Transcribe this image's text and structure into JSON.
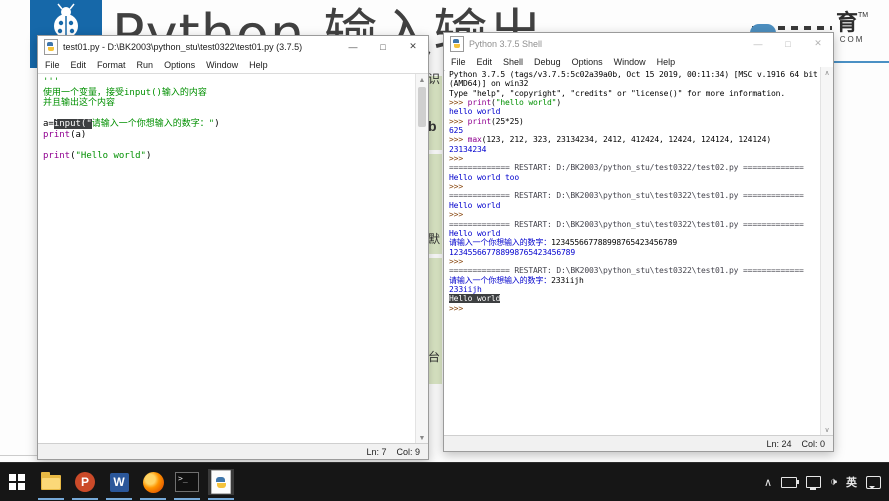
{
  "background": {
    "page_title": "Python 输入输出",
    "logo_icon": "ladybug-icon",
    "right_logo": {
      "char": "育",
      "tm": "TM",
      "com": "COM"
    },
    "strip_fragments": {
      "f1": "识",
      "f2": "b",
      "f3": "默",
      "f4": "台"
    }
  },
  "window_controls": {
    "minimize": "—",
    "maximize": "□",
    "close": "✕"
  },
  "editor_window": {
    "title": "test01.py - D:\\BK2003\\python_stu\\test0322\\test01.py (3.7.5)",
    "menu": [
      "File",
      "Edit",
      "Format",
      "Run",
      "Options",
      "Window",
      "Help"
    ],
    "code_lines": [
      [
        {
          "t": "'''",
          "c": "str"
        }
      ],
      [
        {
          "t": "使用一个变量，接受input()输入的内容",
          "c": "str"
        }
      ],
      [
        {
          "t": "并且输出这个内容",
          "c": "str"
        }
      ],
      [],
      [
        {
          "t": "a=",
          "c": "plain"
        },
        {
          "t": "input(\"",
          "c": "sel"
        },
        {
          "t": "请输入一个你想输入的数字：",
          "c": "str"
        },
        {
          "t": "\"",
          "c": "str"
        },
        {
          "t": ")",
          "c": "plain"
        }
      ],
      [
        {
          "t": "print",
          "c": "builtin"
        },
        {
          "t": "(a)",
          "c": "plain"
        }
      ],
      [],
      [
        {
          "t": "print",
          "c": "builtin"
        },
        {
          "t": "(",
          "c": "plain"
        },
        {
          "t": "\"Hello world\"",
          "c": "str"
        },
        {
          "t": ")",
          "c": "plain"
        }
      ]
    ],
    "status": {
      "line": "Ln: 7",
      "col": "Col: 9"
    }
  },
  "shell_window": {
    "title": "Python 3.7.5 Shell",
    "menu": [
      "File",
      "Edit",
      "Shell",
      "Debug",
      "Options",
      "Window",
      "Help"
    ],
    "lines": [
      [
        {
          "t": "Python 3.7.5 (tags/v3.7.5:5c02a39a0b, Oct 15 2019, 00:11:34) [MSC v.1916 64 bit",
          "c": "plain"
        }
      ],
      [
        {
          "t": "(AMD64)] on win32",
          "c": "plain"
        }
      ],
      [
        {
          "t": "Type \"help\", \"copyright\", \"credits\" or \"license()\" for more information.",
          "c": "plain"
        }
      ],
      [
        {
          "t": ">>> ",
          "c": "prompt"
        },
        {
          "t": "print",
          "c": "builtin"
        },
        {
          "t": "(",
          "c": "plain"
        },
        {
          "t": "\"hello world\"",
          "c": "str"
        },
        {
          "t": ")",
          "c": "plain"
        }
      ],
      [
        {
          "t": "hello world",
          "c": "out"
        }
      ],
      [
        {
          "t": ">>> ",
          "c": "prompt"
        },
        {
          "t": "print",
          "c": "builtin"
        },
        {
          "t": "(25*25)",
          "c": "plain"
        }
      ],
      [
        {
          "t": "625",
          "c": "out"
        }
      ],
      [
        {
          "t": ">>> ",
          "c": "prompt"
        },
        {
          "t": "max",
          "c": "builtin"
        },
        {
          "t": "(123, 212, 323, 23134234, 2412, 412424, 12424, 124124, 124124)",
          "c": "plain"
        }
      ],
      [
        {
          "t": "23134234",
          "c": "out"
        }
      ],
      [
        {
          "t": ">>>",
          "c": "prompt"
        }
      ],
      [
        {
          "t": "============= RESTART: D:/BK2003/python_stu/test0322/test02.py =============",
          "c": "restart"
        }
      ],
      [
        {
          "t": "Hello world too",
          "c": "out"
        }
      ],
      [
        {
          "t": ">>>",
          "c": "prompt"
        }
      ],
      [
        {
          "t": "============= RESTART: D:\\BK2003\\python_stu\\test0322\\test01.py =============",
          "c": "restart"
        }
      ],
      [
        {
          "t": "Hello world",
          "c": "out"
        }
      ],
      [
        {
          "t": ">>>",
          "c": "prompt"
        }
      ],
      [
        {
          "t": "============= RESTART: D:\\BK2003\\python_stu\\test0322\\test01.py =============",
          "c": "restart"
        }
      ],
      [
        {
          "t": "Hello world",
          "c": "out"
        }
      ],
      [
        {
          "t": "请输入一个你想输入的数字：",
          "c": "out"
        },
        {
          "t": "123455667788998765423456789",
          "c": "plain"
        }
      ],
      [
        {
          "t": "123455667788998765423456789",
          "c": "out"
        }
      ],
      [
        {
          "t": ">>>",
          "c": "prompt"
        }
      ],
      [
        {
          "t": "============= RESTART: D:\\BK2003\\python_stu\\test0322\\test01.py =============",
          "c": "restart"
        }
      ],
      [
        {
          "t": "请输入一个你想输入的数字：",
          "c": "out"
        },
        {
          "t": "233iijh",
          "c": "plain"
        }
      ],
      [
        {
          "t": "233iijh",
          "c": "out"
        }
      ],
      [
        {
          "t": "Hello world",
          "c": "sel"
        }
      ],
      [
        {
          "t": ">>>",
          "c": "prompt"
        }
      ]
    ],
    "status": {
      "line": "Ln: 24",
      "col": "Col: 0"
    }
  },
  "taskbar": {
    "app_icons": [
      "start-icon",
      "file-explorer-icon",
      "powerpoint-icon",
      "word-icon",
      "firefox-icon",
      "terminal-icon",
      "python-idle-icon"
    ],
    "powerpoint_letter": "P",
    "word_letter": "W",
    "terminal_glyph": ">_",
    "accent_underline_color": "#76a9d8"
  },
  "tray": {
    "icons": [
      "hidden-icons-chevron-icon",
      "battery-icon",
      "display-icon",
      "speaker-icon",
      "ime-language-indicator",
      "action-center-icon"
    ],
    "chevron": "∧",
    "speaker": "🕩",
    "language": "英"
  }
}
